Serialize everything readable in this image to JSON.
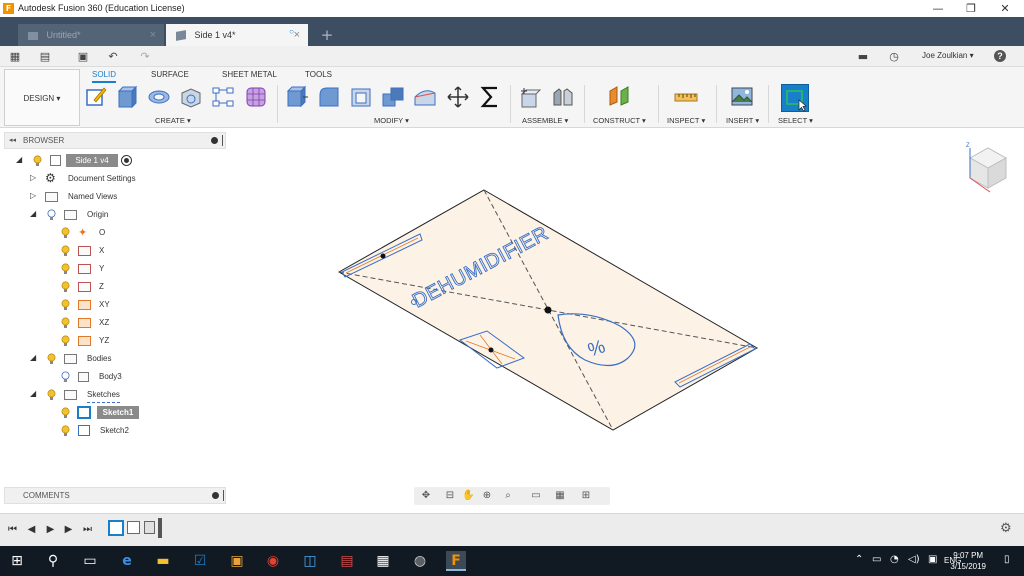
{
  "window": {
    "title": "Autodesk Fusion 360 (Education License)",
    "minimize": "—",
    "restore": "❐",
    "close": "✕"
  },
  "tabs": [
    {
      "label": "Untitled*",
      "active": false
    },
    {
      "label": "Side 1 v4*",
      "active": true
    }
  ],
  "quickbar": {
    "user": "Joe Zoulkian",
    "help": "?"
  },
  "ribbon": {
    "workspace": "DESIGN",
    "tabs": [
      "SOLID",
      "SURFACE",
      "SHEET METAL",
      "TOOLS"
    ],
    "groups": [
      "CREATE",
      "MODIFY",
      "ASSEMBLE",
      "CONSTRUCT",
      "INSPECT",
      "INSERT",
      "SELECT"
    ]
  },
  "browser": {
    "title": "BROWSER",
    "root": "Side 1 v4",
    "items": [
      "Document Settings",
      "Named Views",
      "Origin",
      "O",
      "X",
      "Y",
      "Z",
      "XY",
      "XZ",
      "YZ",
      "Bodies",
      "Body3",
      "Sketches",
      "Sketch1",
      "Sketch2"
    ]
  },
  "model": {
    "text": "DEHUMIDIFIER",
    "symbol": "%"
  },
  "comments": {
    "title": "COMMENTS"
  },
  "taskbar": {
    "lang": "ENG",
    "time": "9:07 PM",
    "date": "3/15/2019"
  },
  "colors": {
    "tabbar": "#3d4e62",
    "accent": "#1a7fc9",
    "sketch_line": "#3a6fc4",
    "plane_fill": "#fdf2e6",
    "taskbar": "#111a23"
  }
}
